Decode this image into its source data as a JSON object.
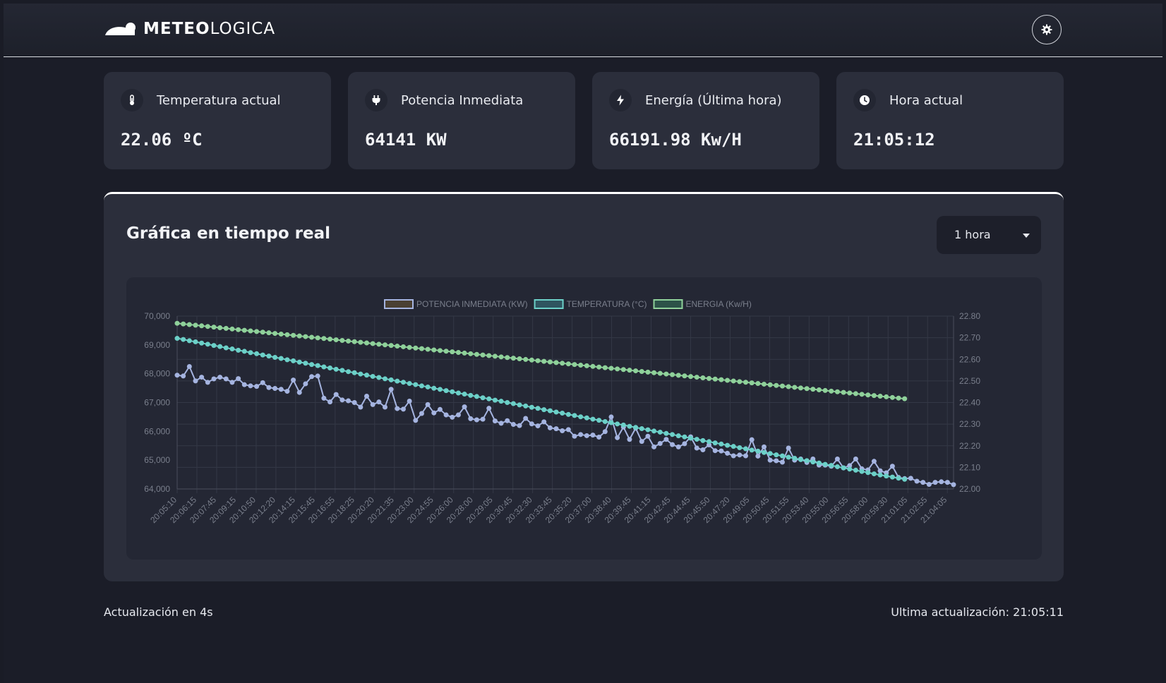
{
  "brand": {
    "name_bold": "METEO",
    "name_light": "LOGICA"
  },
  "header": {
    "settings_icon": "gear-icon"
  },
  "cards": [
    {
      "icon": "thermometer-icon",
      "label": "Temperatura actual",
      "value": "22.06 ºC"
    },
    {
      "icon": "plug-icon",
      "label": "Potencia Inmediata",
      "value": "64141 KW"
    },
    {
      "icon": "bolt-icon",
      "label": "Energía (Última hora)",
      "value": "66191.98 Kw/H"
    },
    {
      "icon": "clock-icon",
      "label": "Hora actual",
      "value": "21:05:12"
    }
  ],
  "panel": {
    "title": "Gráfica en tiempo real",
    "range_select": {
      "selected": "1 hora"
    }
  },
  "footer": {
    "left": "Actualización en 4s",
    "right": "Ultima actualización: 21:05:11"
  },
  "colors": {
    "potencia": "#a5b4e0",
    "temperatura": "#6cd0c8",
    "energia": "#8fd19a",
    "accent_border": "#ffffff"
  },
  "chart_data": {
    "type": "line",
    "legend_position": "top",
    "grid": true,
    "x_tick_labels": [
      "20:05:10",
      "20:06:15",
      "20:07:45",
      "20:09:15",
      "20:10:50",
      "20:12:20",
      "20:14:15",
      "20:15:45",
      "20:16:55",
      "20:18:25",
      "20:20:20",
      "20:21:35",
      "20:23:00",
      "20:24:55",
      "20:26:00",
      "20:28:00",
      "20:29:05",
      "20:30:45",
      "20:32:30",
      "20:33:45",
      "20:35:20",
      "20:37:00",
      "20:38:40",
      "20:39:45",
      "20:41:15",
      "20:42:45",
      "20:44:45",
      "20:45:50",
      "20:47:20",
      "20:49:05",
      "20:50:45",
      "20:51:55",
      "20:53:40",
      "20:55:00",
      "20:56:55",
      "20:58:00",
      "20:59:30",
      "21:01:05",
      "21:02:55",
      "21:04:05"
    ],
    "left_axis": {
      "min": 64000,
      "max": 70000,
      "ticks": [
        "64,000",
        "65,000",
        "66,000",
        "67,000",
        "68,000",
        "69,000",
        "70,000"
      ]
    },
    "right_axis": {
      "min": 22.0,
      "max": 22.8,
      "ticks": [
        "22.00",
        "22.10",
        "22.20",
        "22.30",
        "22.40",
        "22.50",
        "22.60",
        "22.70",
        "22.80"
      ]
    },
    "series": [
      {
        "name": "POTENCIA INMEDIATA (KW)",
        "axis": "left",
        "values": [
          67950,
          67920,
          68250,
          67750,
          67880,
          67700,
          67820,
          67880,
          67820,
          67700,
          67830,
          67620,
          67580,
          67560,
          67690,
          67520,
          67490,
          67460,
          67390,
          67780,
          67350,
          67650,
          67900,
          67920,
          67150,
          67020,
          67280,
          67090,
          67060,
          67000,
          66840,
          67220,
          66930,
          67020,
          66840,
          67460,
          66790,
          66770,
          67050,
          66380,
          66620,
          66930,
          66640,
          66760,
          66570,
          66490,
          66570,
          66850,
          66440,
          66400,
          66420,
          66800,
          66360,
          66280,
          66370,
          66240,
          66200,
          66450,
          66260,
          66190,
          66330,
          66120,
          66090,
          66020,
          66060,
          65830,
          65890,
          65850,
          65870,
          65800,
          65990,
          66500,
          65780,
          66150,
          65720,
          66110,
          65650,
          65830,
          65460,
          65580,
          65720,
          65540,
          65460,
          65570,
          65810,
          65420,
          65360,
          65530,
          65330,
          65320,
          65240,
          65150,
          65180,
          65150,
          65710,
          65140,
          65460,
          65000,
          64980,
          64930,
          65420,
          65000,
          65040,
          64920,
          65040,
          64830,
          64830,
          64790,
          65040,
          64730,
          64810,
          65040,
          64700,
          64660,
          64960,
          64630,
          64560,
          64790,
          64400,
          64360,
          64370,
          64270,
          64230,
          64160,
          64230,
          64250,
          64230,
          64150
        ]
      },
      {
        "name": "TEMPERATURA (°C)",
        "axis": "right",
        "values": [
          22.697,
          22.692,
          22.686,
          22.681,
          22.675,
          22.67,
          22.664,
          22.659,
          22.653,
          22.648,
          22.642,
          22.637,
          22.631,
          22.626,
          22.62,
          22.615,
          22.609,
          22.604,
          22.598,
          22.593,
          22.587,
          22.582,
          22.576,
          22.571,
          22.565,
          22.56,
          22.554,
          22.549,
          22.543,
          22.538,
          22.532,
          22.527,
          22.521,
          22.516,
          22.51,
          22.505,
          22.499,
          22.494,
          22.488,
          22.483,
          22.477,
          22.472,
          22.466,
          22.461,
          22.455,
          22.45,
          22.444,
          22.439,
          22.433,
          22.428,
          22.422,
          22.417,
          22.411,
          22.406,
          22.4,
          22.395,
          22.389,
          22.384,
          22.378,
          22.373,
          22.367,
          22.362,
          22.356,
          22.351,
          22.345,
          22.34,
          22.334,
          22.329,
          22.323,
          22.318,
          22.312,
          22.307,
          22.301,
          22.296,
          22.29,
          22.285,
          22.279,
          22.274,
          22.268,
          22.263,
          22.257,
          22.252,
          22.246,
          22.241,
          22.235,
          22.23,
          22.224,
          22.219,
          22.213,
          22.208,
          22.202,
          22.197,
          22.191,
          22.186,
          22.18,
          22.175,
          22.169,
          22.164,
          22.158,
          22.153,
          22.147,
          22.142,
          22.136,
          22.131,
          22.125,
          22.12,
          22.114,
          22.109,
          22.103,
          22.098,
          22.092,
          22.087,
          22.081,
          22.076,
          22.07,
          22.065,
          22.06,
          22.055,
          22.05,
          22.045
        ]
      },
      {
        "name": "ENERGIA (Kw/H)",
        "axis": "left",
        "values": [
          69750,
          69728,
          69706,
          69684,
          69662,
          69640,
          69618,
          69596,
          69574,
          69552,
          69530,
          69508,
          69486,
          69464,
          69442,
          69420,
          69398,
          69376,
          69354,
          69332,
          69310,
          69288,
          69266,
          69244,
          69222,
          69200,
          69178,
          69156,
          69134,
          69112,
          69090,
          69068,
          69046,
          69024,
          69002,
          68980,
          68958,
          68936,
          68914,
          68892,
          68870,
          68848,
          68826,
          68804,
          68782,
          68760,
          68738,
          68716,
          68694,
          68672,
          68650,
          68628,
          68606,
          68584,
          68562,
          68540,
          68518,
          68496,
          68474,
          68452,
          68430,
          68408,
          68386,
          68364,
          68342,
          68320,
          68298,
          68276,
          68254,
          68232,
          68210,
          68188,
          68166,
          68144,
          68122,
          68100,
          68078,
          68056,
          68034,
          68012,
          67990,
          67968,
          67946,
          67924,
          67902,
          67880,
          67858,
          67836,
          67814,
          67792,
          67770,
          67748,
          67726,
          67704,
          67682,
          67660,
          67638,
          67616,
          67594,
          67572,
          67550,
          67528,
          67506,
          67484,
          67462,
          67440,
          67418,
          67396,
          67374,
          67352,
          67330,
          67308,
          67286,
          67264,
          67242,
          67220,
          67198,
          67176,
          67154,
          67132
        ]
      }
    ]
  }
}
